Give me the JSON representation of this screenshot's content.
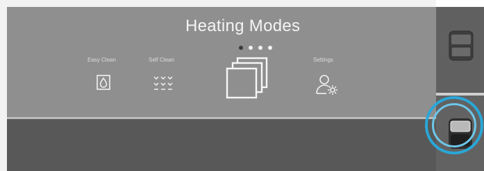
{
  "screen": {
    "title": "Heating Modes",
    "page_indicator": {
      "total": 4,
      "active_index": 0
    }
  },
  "modes": [
    {
      "label": "Easy Clean",
      "icon": "water-drop-icon"
    },
    {
      "label": "Self Clean",
      "icon": "heat-waves-icon"
    },
    {
      "label": "",
      "icon": "stacked-windows-icon"
    },
    {
      "label": "Settings",
      "icon": "user-settings-icon"
    }
  ],
  "side_controls": {
    "upper_oven_button_icon": "upper-oven-icon",
    "lower_oven_button_icon": "lower-oven-icon"
  },
  "colors": {
    "screen_bg": "#8f8f8f",
    "lower_bg": "#585858",
    "highlight": "#2aa7d8"
  }
}
